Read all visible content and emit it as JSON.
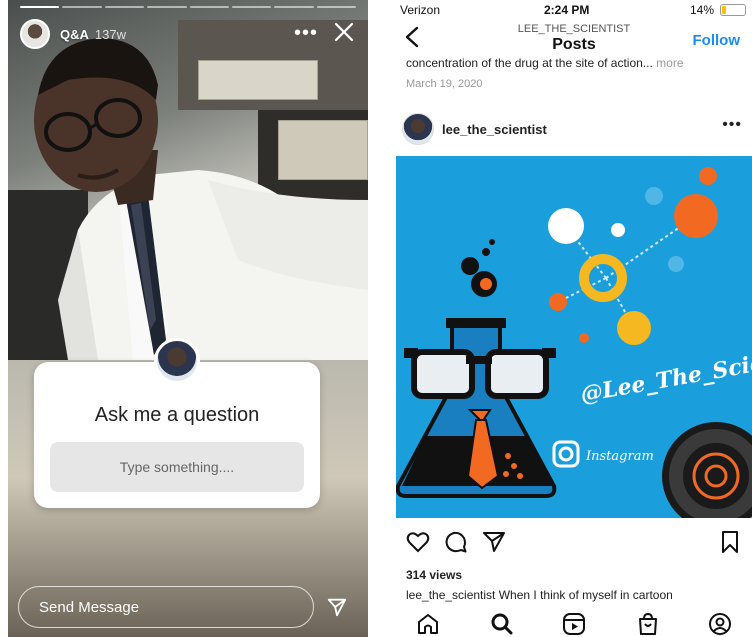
{
  "story": {
    "username": "Q&A",
    "timestamp": "137w",
    "more_label": "•••",
    "question": {
      "title": "Ask me a question",
      "placeholder": "Type something...."
    },
    "send_message": {
      "placeholder": "Send Message"
    }
  },
  "post_view": {
    "status_bar": {
      "carrier": "Verizon",
      "time": "2:24 PM",
      "battery": "14%"
    },
    "nav": {
      "subtitle": "LEE_THE_SCIENTIST",
      "title": "Posts",
      "follow_label": "Follow"
    },
    "previous_post": {
      "caption": "concentration of the drug at the site of action...",
      "more_label": "more",
      "date": "March 19, 2020"
    },
    "post": {
      "username": "lee_the_scientist",
      "more_label": "•••",
      "image_text": "@Lee_The_Scientist",
      "image_subtext": "Instagram",
      "views": "314 views",
      "caption_user": "lee_the_scientist",
      "caption_text": "When I think of myself in cartoon"
    },
    "tabbar": {
      "items": [
        "home-icon",
        "search-icon",
        "reels-icon",
        "shop-icon",
        "profile-icon"
      ]
    }
  },
  "colors": {
    "accent_blue": "#1a8ef0",
    "post_bg": "#1b9fdc",
    "orange": "#f26a21",
    "yellow": "#f5b820"
  }
}
